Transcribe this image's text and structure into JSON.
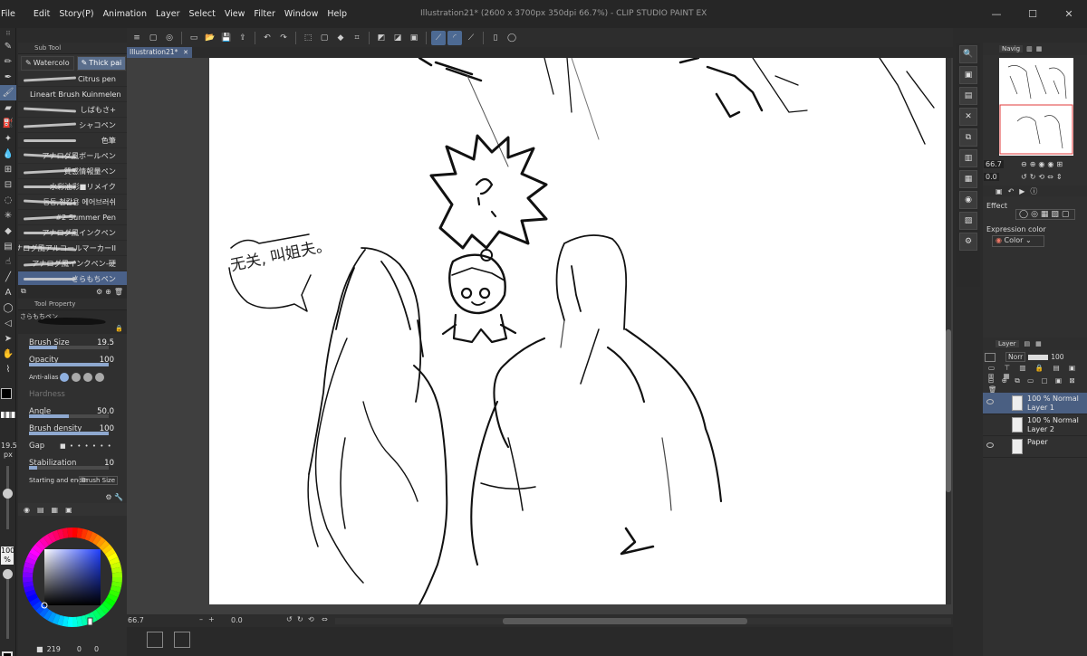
{
  "window": {
    "title": "Illustration21* (2600 x 3700px 350dpi 66.7%)  - CLIP STUDIO PAINT EX",
    "controls": [
      "—",
      "☐",
      "✕"
    ]
  },
  "menu": [
    "File",
    "Edit",
    "Story(P)",
    "Animation",
    "Layer",
    "Select",
    "View",
    "Filter",
    "Window",
    "Help"
  ],
  "sub_tool": {
    "panel_title": "Sub Tool",
    "tabs": [
      {
        "label": "Watercolo"
      },
      {
        "label": "Thick pai"
      }
    ],
    "brushes": [
      {
        "name": "Citrus pen",
        "wide": false
      },
      {
        "name": "Lineart Brush Kuinmelen",
        "wide": true
      },
      {
        "name": "しばもさ+",
        "wide": false
      },
      {
        "name": "シャコペン",
        "wide": false
      },
      {
        "name": "色筆",
        "wide": false
      },
      {
        "name": "アナログ風ボールペン",
        "wide": false
      },
      {
        "name": "質感情報量ペン",
        "wide": false
      },
      {
        "name": "水彩油彩■リメイク",
        "wide": false
      },
      {
        "name": "동동,철칼용 에어브러쉬",
        "wide": false
      },
      {
        "name": "#2 Summer Pen",
        "wide": false
      },
      {
        "name": "アナログ風インクペン",
        "wide": false
      },
      {
        "name": "アナログ風アルコールマーカーII",
        "wide": false
      },
      {
        "name": "アナログ風インクペン-硬",
        "wide": false
      },
      {
        "name": "さらもちペン",
        "wide": false,
        "selected": true
      }
    ]
  },
  "tool_property": {
    "panel_title": "Tool Property",
    "brush_name": "さらもちペン",
    "brush_size_label": "Brush Size",
    "brush_size": "19.5",
    "brush_size_fill": 0.35,
    "opacity_label": "Opacity",
    "opacity": "100",
    "opacity_fill": 1.0,
    "antialias_label": "Anti-alias",
    "hardness_label": "Hardness",
    "angle_label": "Angle",
    "angle": "50.0",
    "angle_fill": 0.5,
    "density_label": "Brush density",
    "density": "100",
    "density_fill": 1.0,
    "gap_label": "Gap",
    "stabilization_label": "Stabilization",
    "stabilization": "10",
    "stabilization_fill": 0.1,
    "start_end_label": "Starting and endin",
    "start_end_value": "Brush Size"
  },
  "left_status": {
    "size_value": "19.5",
    "size_unit": "px",
    "opacity_value": "100",
    "opacity_unit": "%"
  },
  "color_panel": {
    "selected_hue": "#2040ff",
    "readout": "219",
    "readout2": "0",
    "readout3": "0"
  },
  "document_tab": "Illustration21*",
  "canvas_status": {
    "zoom": "66.7",
    "rotation": "0.0"
  },
  "navigator": {
    "tab": "Navig",
    "zoom": "66.7",
    "rotation": "0.0"
  },
  "effect": {
    "title": "Effect",
    "expression_label": "Expression color",
    "expression_value": "Color"
  },
  "layers": {
    "tab": "Layer",
    "blend_mode": "Norr",
    "opacity": "100",
    "items": [
      {
        "line1": "100 % Normal",
        "line2": "Layer 1",
        "selected": true,
        "visible": true
      },
      {
        "line1": "100 % Normal",
        "line2": "Layer 2",
        "selected": false,
        "visible": false
      },
      {
        "line1": "",
        "line2": "Paper",
        "selected": false,
        "visible": true
      }
    ]
  },
  "sketch_text": "无关, 叫姐夫。"
}
